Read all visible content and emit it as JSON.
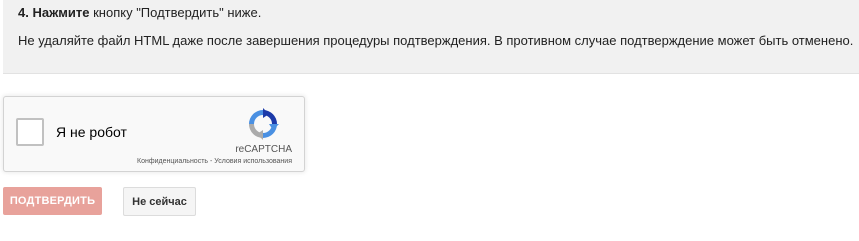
{
  "step": {
    "number_bold": "4. Нажмите",
    "rest": " кнопку \"Подтвердить\" ниже.",
    "note": "Не удаляйте файл HTML даже после завершения процедуры подтверждения. В противном случае подтверждение может быть отменено."
  },
  "recaptcha": {
    "checkbox_label": "Я не робот",
    "brand": "reCAPTCHA",
    "privacy_link": "Конфиденциальность",
    "separator": " - ",
    "terms_link": "Условия использования",
    "logo_icon": "recaptcha-logo-icon",
    "checked": false
  },
  "buttons": {
    "confirm_label": "ПОДТВЕРДИТЬ",
    "later_label": "Не сейчас"
  },
  "colors": {
    "confirm_bg": "#e8a29b",
    "recaptcha_blue": "#4a90e2",
    "recaptcha_dark_blue": "#1c3aa9",
    "recaptcha_gray": "#ababab"
  }
}
